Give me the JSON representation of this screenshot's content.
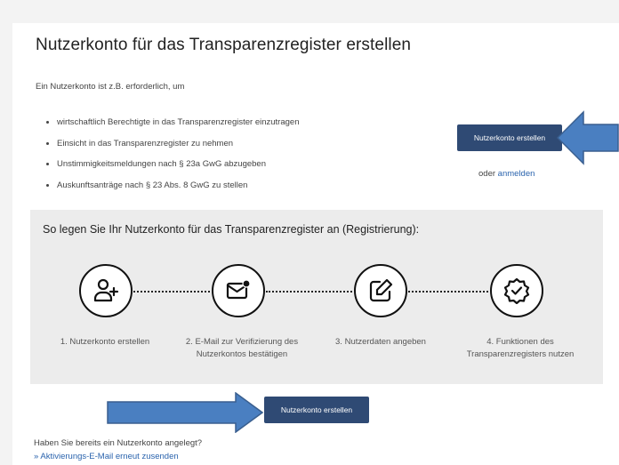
{
  "page": {
    "title": "Nutzerkonto für das Transparenzregister erstellen",
    "intro": "Ein Nutzerkonto ist z.B. erforderlich, um",
    "bullets": [
      "wirtschaftlich Berechtigte in das Transparenzregister einzutragen",
      "Einsicht in das Transparenzregister zu nehmen",
      "Unstimmigkeitsmeldungen nach § 23a GwG abzugeben",
      "Auskunftsanträge nach § 23 Abs. 8 GwG zu stellen"
    ],
    "create_button": "Nutzerkonto erstellen",
    "or_text": "oder ",
    "login_link": "anmelden"
  },
  "steps_section": {
    "title": "So legen Sie Ihr Nutzerkonto für das Transparenzregister an (Registrierung):",
    "steps": [
      {
        "icon": "user-plus-icon",
        "label_line1": "1. Nutzerkonto erstellen",
        "label_line2": ""
      },
      {
        "icon": "mail-check-icon",
        "label_line1": "2. E-Mail zur Verifizierung des",
        "label_line2": "Nutzerkontos bestätigen"
      },
      {
        "icon": "edit-icon",
        "label_line1": "3. Nutzerdaten angeben",
        "label_line2": ""
      },
      {
        "icon": "badge-check-icon",
        "label_line1": "4. Funktionen des",
        "label_line2": "Transparenzregisters nutzen"
      }
    ],
    "create_button": "Nutzerkonto erstellen"
  },
  "footer": {
    "question": "Haben Sie bereits ein Nutzerkonto angelegt?",
    "resend_link": "» Aktivierungs-E-Mail erneut zusenden"
  },
  "colors": {
    "button": "#2f4a74",
    "link": "#2a63ad",
    "arrow_fill": "#4a7fc1",
    "arrow_stroke": "#3a5f8f"
  }
}
